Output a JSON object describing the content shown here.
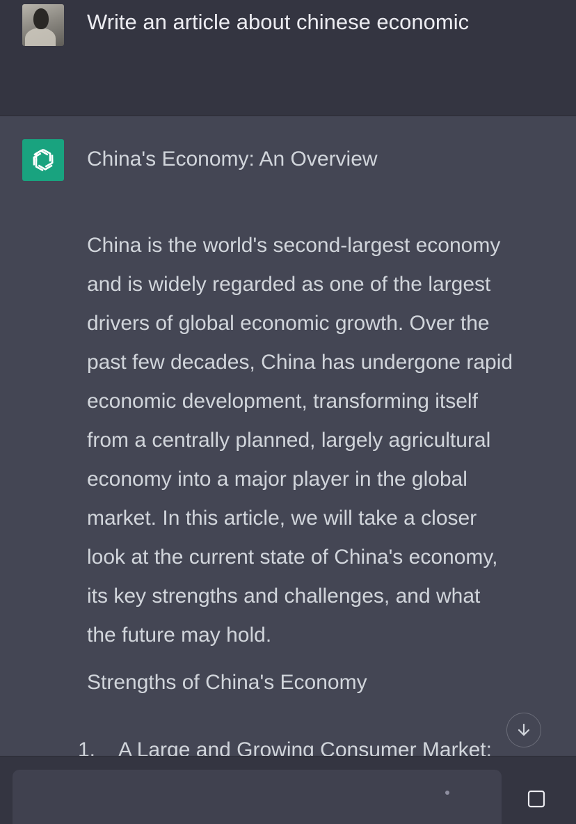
{
  "conversation": {
    "user_message": {
      "avatar_icon": "user-photo-avatar",
      "text": "Write an article about chinese economic"
    },
    "assistant_message": {
      "avatar_icon": "openai-logo-icon",
      "avatar_color": "#19a37f",
      "title": "China's Economy: An Overview",
      "paragraph_lines": [
        "China is the world's second-largest economy",
        "and is widely regarded as one of the largest",
        "drivers of global economic growth. Over the",
        "past few decades, China has undergone rapid",
        "economic development, transforming itself",
        "from a centrally planned, largely agricultural",
        "economy into a major player in the global",
        "market. In this article, we will take a closer",
        "look at the current state of China's economy,",
        "its key strengths and challenges, and what",
        "the future may hold."
      ],
      "section_heading": "Strengths of China's Economy",
      "list_items": [
        {
          "number": "1.",
          "text": "A Large and Growing Consumer Market:"
        }
      ]
    }
  },
  "controls": {
    "scroll_down_icon": "arrow-down-icon",
    "input_placeholder": "",
    "stop_icon": "stop-square-icon"
  },
  "colors": {
    "background_user": "#343541",
    "background_assistant": "#444654",
    "text": "#d1d5db",
    "accent": "#19a37f"
  }
}
